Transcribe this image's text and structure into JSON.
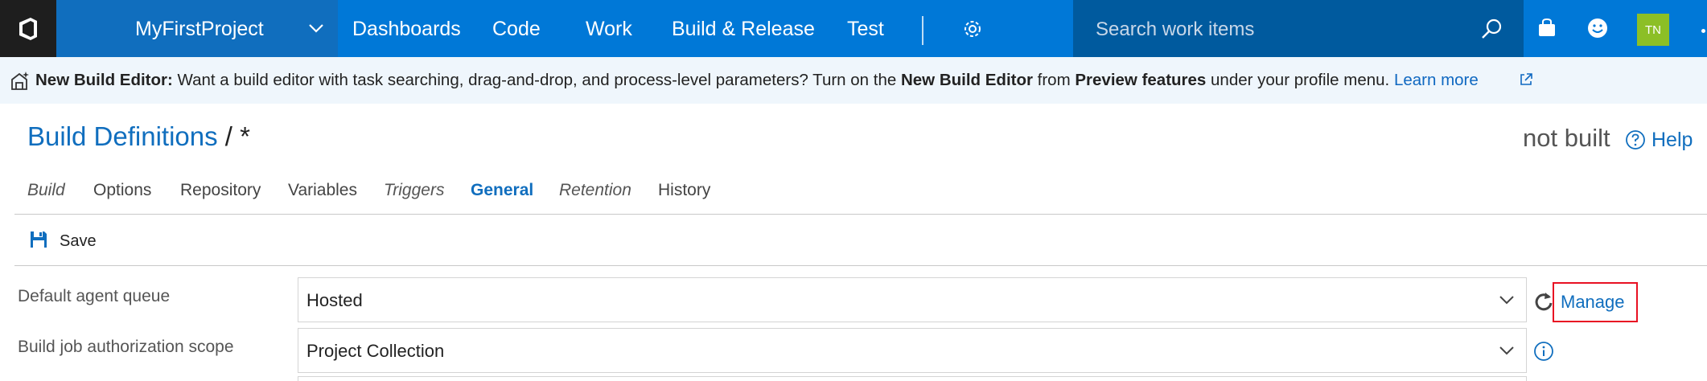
{
  "topbar": {
    "project_name": "MyFirstProject",
    "nav": [
      "Dashboards",
      "Code",
      "Work",
      "Build & Release",
      "Test"
    ],
    "search_placeholder": "Search work items",
    "avatar_initials": "TN",
    "colors": {
      "bar": "#0078d7",
      "project": "#106ebe",
      "search": "#005a9e",
      "logo": "#1e1e1e",
      "avatar": "#8cbf26"
    }
  },
  "banner": {
    "title": "New Build Editor:",
    "text1": " Want a build editor with task searching, drag-and-drop, and process-level parameters? Turn on the ",
    "bold1": "New Build Editor",
    "text2": " from ",
    "bold2": "Preview features",
    "text3": " under your profile menu. ",
    "link": "Learn more"
  },
  "header": {
    "breadcrumb_link": "Build Definitions",
    "breadcrumb_rest": " / *",
    "status": "not built",
    "help": "Help"
  },
  "tabs": [
    {
      "label": "Build",
      "style": "italic"
    },
    {
      "label": "Options",
      "style": "normal"
    },
    {
      "label": "Repository",
      "style": "normal"
    },
    {
      "label": "Variables",
      "style": "normal"
    },
    {
      "label": "Triggers",
      "style": "italic"
    },
    {
      "label": "General",
      "style": "active"
    },
    {
      "label": "Retention",
      "style": "italic"
    },
    {
      "label": "History",
      "style": "normal"
    }
  ],
  "toolbar": {
    "save": "Save"
  },
  "form": {
    "agent_queue_label": "Default agent queue",
    "agent_queue_value": "Hosted",
    "manage_link": "Manage",
    "auth_scope_label": "Build job authorization scope",
    "auth_scope_value": "Project Collection"
  }
}
